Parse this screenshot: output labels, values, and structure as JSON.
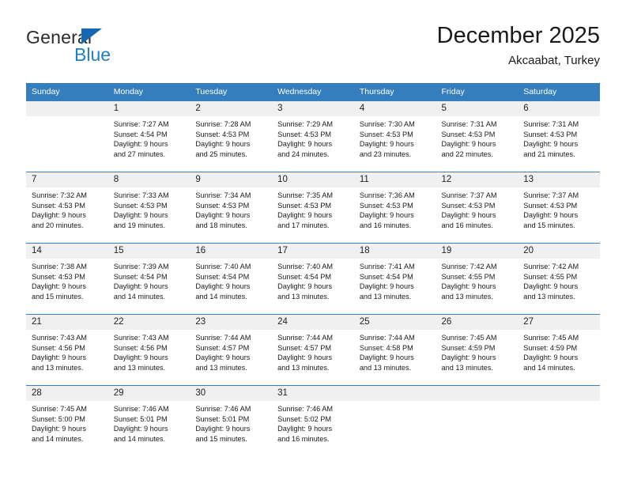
{
  "brand": {
    "name_top": "General",
    "name_bottom": "Blue",
    "accent_color": "#1668b3"
  },
  "header": {
    "title": "December 2025",
    "subtitle": "Akcaabat, Turkey"
  },
  "theme": {
    "header_blue": "#357ebd",
    "row_divider_blue": "#3c7fbf",
    "daynum_band": "#f0f0f0"
  },
  "weekday_headers": [
    "Sunday",
    "Monday",
    "Tuesday",
    "Wednesday",
    "Thursday",
    "Friday",
    "Saturday"
  ],
  "weeks": [
    [
      {
        "day": "",
        "empty": true,
        "sunrise": "",
        "sunset": "",
        "daylight1": "",
        "daylight2": ""
      },
      {
        "day": "1",
        "sunrise": "Sunrise: 7:27 AM",
        "sunset": "Sunset: 4:54 PM",
        "daylight1": "Daylight: 9 hours",
        "daylight2": "and 27 minutes."
      },
      {
        "day": "2",
        "sunrise": "Sunrise: 7:28 AM",
        "sunset": "Sunset: 4:53 PM",
        "daylight1": "Daylight: 9 hours",
        "daylight2": "and 25 minutes."
      },
      {
        "day": "3",
        "sunrise": "Sunrise: 7:29 AM",
        "sunset": "Sunset: 4:53 PM",
        "daylight1": "Daylight: 9 hours",
        "daylight2": "and 24 minutes."
      },
      {
        "day": "4",
        "sunrise": "Sunrise: 7:30 AM",
        "sunset": "Sunset: 4:53 PM",
        "daylight1": "Daylight: 9 hours",
        "daylight2": "and 23 minutes."
      },
      {
        "day": "5",
        "sunrise": "Sunrise: 7:31 AM",
        "sunset": "Sunset: 4:53 PM",
        "daylight1": "Daylight: 9 hours",
        "daylight2": "and 22 minutes."
      },
      {
        "day": "6",
        "sunrise": "Sunrise: 7:31 AM",
        "sunset": "Sunset: 4:53 PM",
        "daylight1": "Daylight: 9 hours",
        "daylight2": "and 21 minutes."
      }
    ],
    [
      {
        "day": "7",
        "sunrise": "Sunrise: 7:32 AM",
        "sunset": "Sunset: 4:53 PM",
        "daylight1": "Daylight: 9 hours",
        "daylight2": "and 20 minutes."
      },
      {
        "day": "8",
        "sunrise": "Sunrise: 7:33 AM",
        "sunset": "Sunset: 4:53 PM",
        "daylight1": "Daylight: 9 hours",
        "daylight2": "and 19 minutes."
      },
      {
        "day": "9",
        "sunrise": "Sunrise: 7:34 AM",
        "sunset": "Sunset: 4:53 PM",
        "daylight1": "Daylight: 9 hours",
        "daylight2": "and 18 minutes."
      },
      {
        "day": "10",
        "sunrise": "Sunrise: 7:35 AM",
        "sunset": "Sunset: 4:53 PM",
        "daylight1": "Daylight: 9 hours",
        "daylight2": "and 17 minutes."
      },
      {
        "day": "11",
        "sunrise": "Sunrise: 7:36 AM",
        "sunset": "Sunset: 4:53 PM",
        "daylight1": "Daylight: 9 hours",
        "daylight2": "and 16 minutes."
      },
      {
        "day": "12",
        "sunrise": "Sunrise: 7:37 AM",
        "sunset": "Sunset: 4:53 PM",
        "daylight1": "Daylight: 9 hours",
        "daylight2": "and 16 minutes."
      },
      {
        "day": "13",
        "sunrise": "Sunrise: 7:37 AM",
        "sunset": "Sunset: 4:53 PM",
        "daylight1": "Daylight: 9 hours",
        "daylight2": "and 15 minutes."
      }
    ],
    [
      {
        "day": "14",
        "sunrise": "Sunrise: 7:38 AM",
        "sunset": "Sunset: 4:53 PM",
        "daylight1": "Daylight: 9 hours",
        "daylight2": "and 15 minutes."
      },
      {
        "day": "15",
        "sunrise": "Sunrise: 7:39 AM",
        "sunset": "Sunset: 4:54 PM",
        "daylight1": "Daylight: 9 hours",
        "daylight2": "and 14 minutes."
      },
      {
        "day": "16",
        "sunrise": "Sunrise: 7:40 AM",
        "sunset": "Sunset: 4:54 PM",
        "daylight1": "Daylight: 9 hours",
        "daylight2": "and 14 minutes."
      },
      {
        "day": "17",
        "sunrise": "Sunrise: 7:40 AM",
        "sunset": "Sunset: 4:54 PM",
        "daylight1": "Daylight: 9 hours",
        "daylight2": "and 13 minutes."
      },
      {
        "day": "18",
        "sunrise": "Sunrise: 7:41 AM",
        "sunset": "Sunset: 4:54 PM",
        "daylight1": "Daylight: 9 hours",
        "daylight2": "and 13 minutes."
      },
      {
        "day": "19",
        "sunrise": "Sunrise: 7:42 AM",
        "sunset": "Sunset: 4:55 PM",
        "daylight1": "Daylight: 9 hours",
        "daylight2": "and 13 minutes."
      },
      {
        "day": "20",
        "sunrise": "Sunrise: 7:42 AM",
        "sunset": "Sunset: 4:55 PM",
        "daylight1": "Daylight: 9 hours",
        "daylight2": "and 13 minutes."
      }
    ],
    [
      {
        "day": "21",
        "sunrise": "Sunrise: 7:43 AM",
        "sunset": "Sunset: 4:56 PM",
        "daylight1": "Daylight: 9 hours",
        "daylight2": "and 13 minutes."
      },
      {
        "day": "22",
        "sunrise": "Sunrise: 7:43 AM",
        "sunset": "Sunset: 4:56 PM",
        "daylight1": "Daylight: 9 hours",
        "daylight2": "and 13 minutes."
      },
      {
        "day": "23",
        "sunrise": "Sunrise: 7:44 AM",
        "sunset": "Sunset: 4:57 PM",
        "daylight1": "Daylight: 9 hours",
        "daylight2": "and 13 minutes."
      },
      {
        "day": "24",
        "sunrise": "Sunrise: 7:44 AM",
        "sunset": "Sunset: 4:57 PM",
        "daylight1": "Daylight: 9 hours",
        "daylight2": "and 13 minutes."
      },
      {
        "day": "25",
        "sunrise": "Sunrise: 7:44 AM",
        "sunset": "Sunset: 4:58 PM",
        "daylight1": "Daylight: 9 hours",
        "daylight2": "and 13 minutes."
      },
      {
        "day": "26",
        "sunrise": "Sunrise: 7:45 AM",
        "sunset": "Sunset: 4:59 PM",
        "daylight1": "Daylight: 9 hours",
        "daylight2": "and 13 minutes."
      },
      {
        "day": "27",
        "sunrise": "Sunrise: 7:45 AM",
        "sunset": "Sunset: 4:59 PM",
        "daylight1": "Daylight: 9 hours",
        "daylight2": "and 14 minutes."
      }
    ],
    [
      {
        "day": "28",
        "sunrise": "Sunrise: 7:45 AM",
        "sunset": "Sunset: 5:00 PM",
        "daylight1": "Daylight: 9 hours",
        "daylight2": "and 14 minutes."
      },
      {
        "day": "29",
        "sunrise": "Sunrise: 7:46 AM",
        "sunset": "Sunset: 5:01 PM",
        "daylight1": "Daylight: 9 hours",
        "daylight2": "and 14 minutes."
      },
      {
        "day": "30",
        "sunrise": "Sunrise: 7:46 AM",
        "sunset": "Sunset: 5:01 PM",
        "daylight1": "Daylight: 9 hours",
        "daylight2": "and 15 minutes."
      },
      {
        "day": "31",
        "sunrise": "Sunrise: 7:46 AM",
        "sunset": "Sunset: 5:02 PM",
        "daylight1": "Daylight: 9 hours",
        "daylight2": "and 16 minutes."
      },
      {
        "day": "",
        "empty": true,
        "sunrise": "",
        "sunset": "",
        "daylight1": "",
        "daylight2": ""
      },
      {
        "day": "",
        "empty": true,
        "sunrise": "",
        "sunset": "",
        "daylight1": "",
        "daylight2": ""
      },
      {
        "day": "",
        "empty": true,
        "sunrise": "",
        "sunset": "",
        "daylight1": "",
        "daylight2": ""
      }
    ]
  ]
}
